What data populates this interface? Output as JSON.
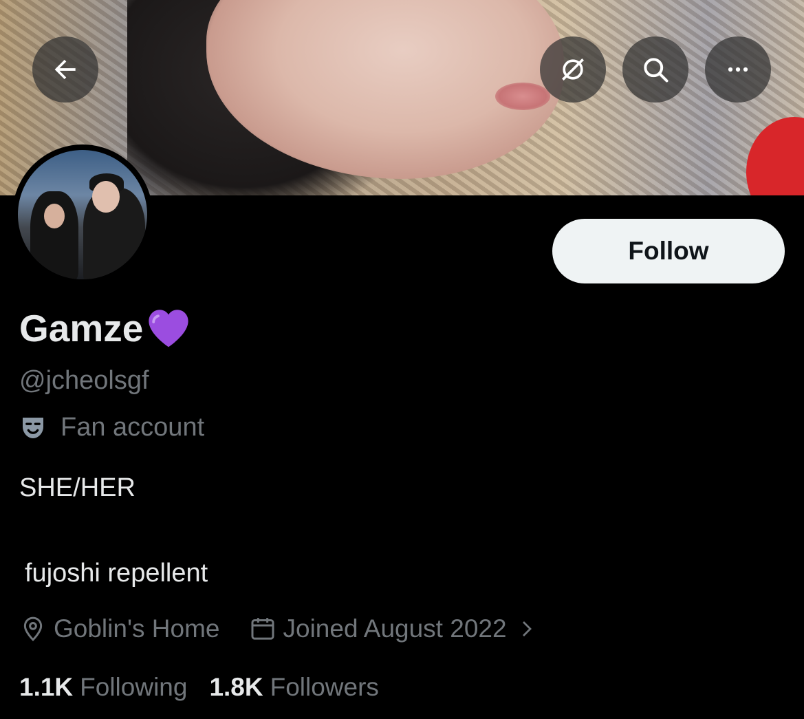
{
  "header": {
    "back_icon": "arrow-left-icon",
    "grok_icon": "grok-icon",
    "search_icon": "search-icon",
    "more_icon": "more-icon"
  },
  "profile": {
    "display_name": "Gamze",
    "name_emoji": "purple-heart",
    "handle": "@jcheolsgf",
    "category_icon": "theater-masks-icon",
    "category": "Fan account",
    "bio_line1": "SHE/HER",
    "bio_line2": "fujoshi repellent",
    "location": "Goblin's Home",
    "joined": "Joined August 2022",
    "following_count": "1.1K",
    "following_label": "Following",
    "followers_count": "1.8K",
    "followers_label": "Followers"
  },
  "actions": {
    "follow_label": "Follow"
  },
  "colors": {
    "background": "#000000",
    "primary_text": "#e7e9ea",
    "secondary_text": "#71767b",
    "follow_button_bg": "#eff3f4",
    "heart": "#9b4de0"
  }
}
